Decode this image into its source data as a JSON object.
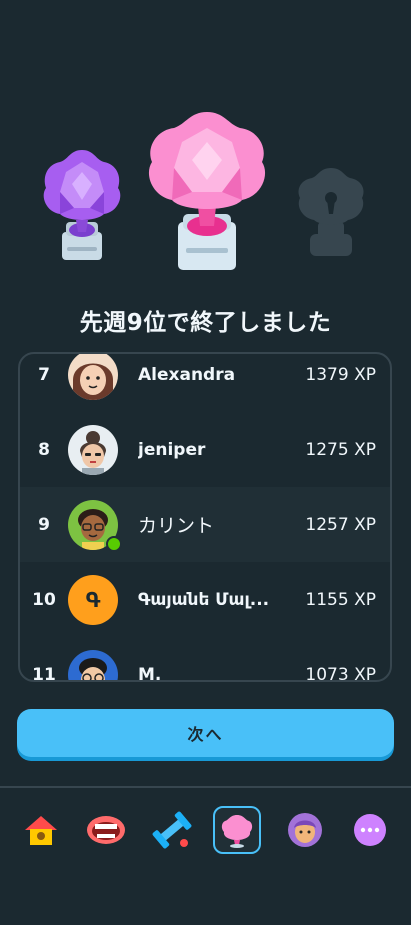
{
  "header": {
    "title": "先週9位で終了しました"
  },
  "leaderboard": {
    "rows": [
      {
        "rank": "7",
        "name": "Alexandra",
        "xp": "1379 XP"
      },
      {
        "rank": "8",
        "name": "jeniper",
        "xp": "1275 XP"
      },
      {
        "rank": "9",
        "name": "カリント",
        "xp": "1257 XP"
      },
      {
        "rank": "10",
        "name": "Գայանե Մալ...",
        "xp": "1155 XP",
        "avatar_letter": "Գ"
      },
      {
        "rank": "11",
        "name": "M.",
        "xp": "1073 XP"
      }
    ]
  },
  "actions": {
    "next_label": "次へ"
  },
  "nav": {
    "items": [
      "home-icon",
      "characters-icon",
      "practice-icon",
      "leagues-icon",
      "profile-icon",
      "more-icon"
    ]
  },
  "colors": {
    "background": "#1b2930",
    "accent": "#49c0f8",
    "highlight_row": "#202f36",
    "border": "#37464f"
  }
}
